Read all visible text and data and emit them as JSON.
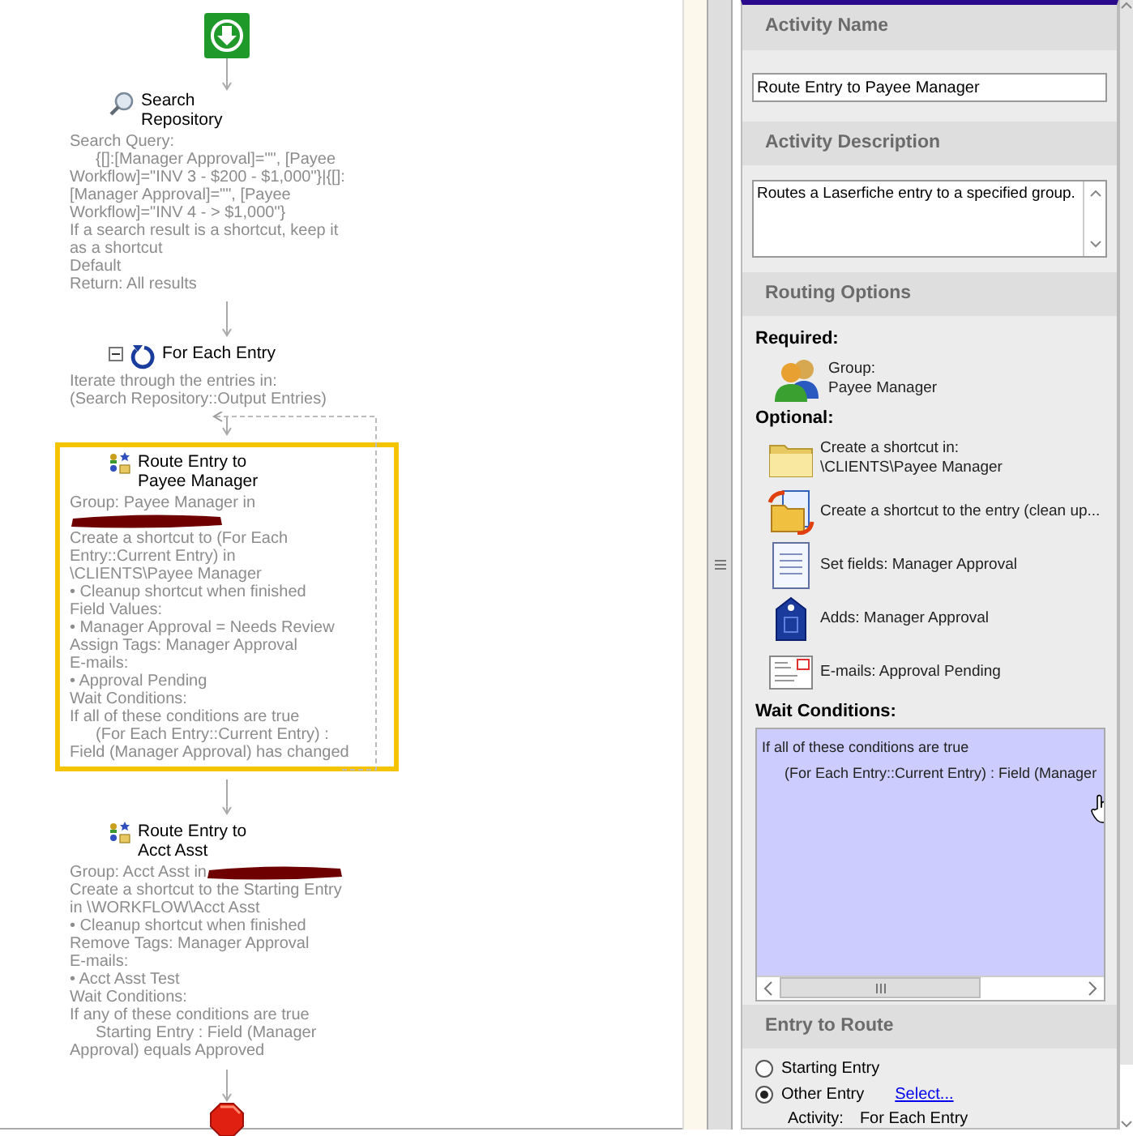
{
  "flow": [
    {
      "kind": "search",
      "title": "Search Repository",
      "selected": false,
      "lines": [
        {
          "text": "Search Query:",
          "indent": false,
          "redacted": false
        },
        {
          "text": "{[]:[Manager Approval]=\"\", [Payee Workflow]=\"INV 3 - $200 - $1,000\"}|{[]:[Manager Approval]=\"\", [Payee Workflow]=\"INV 4 - > $1,000\"}",
          "indent": true,
          "redacted": false
        },
        {
          "text": "If a search result is a shortcut, keep it as a shortcut",
          "indent": false,
          "redacted": false
        },
        {
          "text": "Default",
          "indent": false,
          "redacted": false
        },
        {
          "text": "Return: All results",
          "indent": false,
          "redacted": false
        }
      ]
    },
    {
      "kind": "loop",
      "title": "For Each Entry",
      "expanded": true,
      "selected": false,
      "lines": [
        {
          "text": "Iterate through the entries in:",
          "indent": false,
          "redacted": false
        },
        {
          "text": "(Search Repository::Output Entries)",
          "indent": false,
          "redacted": false
        }
      ]
    },
    {
      "kind": "route",
      "title": "Route Entry to Payee Manager",
      "selected": true,
      "lines": [
        {
          "text": "Group: Payee Manager in",
          "indent": false,
          "redacted": true
        },
        {
          "text": "Create a shortcut to (For Each Entry::Current Entry) in \\CLIENTS\\Payee Manager",
          "indent": false,
          "redacted": false
        },
        {
          "text": "• Cleanup shortcut when finished",
          "indent": false,
          "redacted": false
        },
        {
          "text": "Field Values:",
          "indent": false,
          "redacted": false
        },
        {
          "text": "• Manager Approval = Needs Review",
          "indent": false,
          "redacted": false
        },
        {
          "text": "Assign Tags: Manager Approval",
          "indent": false,
          "redacted": false
        },
        {
          "text": "E-mails:",
          "indent": false,
          "redacted": false
        },
        {
          "text": "• Approval Pending",
          "indent": false,
          "redacted": false
        },
        {
          "text": "Wait Conditions:",
          "indent": false,
          "redacted": false
        },
        {
          "text": "If all of these conditions are true",
          "indent": false,
          "redacted": false
        },
        {
          "text": "(For Each Entry::Current Entry) : Field (Manager Approval) has changed",
          "indent": true,
          "redacted": false
        }
      ]
    },
    {
      "kind": "route",
      "title": "Route Entry to Acct Asst",
      "selected": false,
      "lines": [
        {
          "text": "Group: Acct Asst in",
          "indent": false,
          "redacted": true
        },
        {
          "text": "Create a shortcut to the Starting Entry in \\WORKFLOW\\Acct Asst",
          "indent": false,
          "redacted": false
        },
        {
          "text": "• Cleanup shortcut when finished",
          "indent": false,
          "redacted": false
        },
        {
          "text": "Remove Tags: Manager Approval",
          "indent": false,
          "redacted": false
        },
        {
          "text": "E-mails:",
          "indent": false,
          "redacted": false
        },
        {
          "text": "• Acct Asst Test",
          "indent": false,
          "redacted": false
        },
        {
          "text": "Wait Conditions:",
          "indent": false,
          "redacted": false
        },
        {
          "text": "If any of these conditions are true",
          "indent": false,
          "redacted": false
        },
        {
          "text": "Starting Entry : Field (Manager Approval) equals Approved",
          "indent": true,
          "redacted": false
        }
      ]
    }
  ],
  "properties": {
    "activity_name": {
      "heading": "Activity Name",
      "value": "Route Entry to Payee Manager"
    },
    "activity_description": {
      "heading": "Activity Description",
      "value": "Routes a Laserfiche entry to a specified group."
    },
    "routing_options": {
      "heading": "Routing Options",
      "required_label": "Required:",
      "required": [
        {
          "kind": "group",
          "lines": [
            "Group:",
            "Payee Manager"
          ]
        }
      ],
      "optional_label": "Optional:",
      "optional": [
        {
          "kind": "folder",
          "lines": [
            "Create a shortcut in:",
            "\\CLIENTS\\Payee Manager"
          ]
        },
        {
          "kind": "shortcut",
          "lines": [
            "Create a shortcut to the entry (clean up..."
          ]
        },
        {
          "kind": "fields",
          "lines": [
            "Set fields: Manager Approval"
          ]
        },
        {
          "kind": "tag",
          "lines": [
            "Adds: Manager Approval"
          ]
        },
        {
          "kind": "email",
          "lines": [
            "E-mails: Approval Pending"
          ]
        }
      ],
      "wait_label": "Wait Conditions:",
      "wait_lines": [
        {
          "text": "If all of these conditions are true",
          "indent": false
        },
        {
          "text": "(For Each Entry::Current Entry) : Field (Manager",
          "indent": true
        }
      ]
    },
    "entry_to_route": {
      "heading": "Entry to Route",
      "options": [
        {
          "label": "Starting Entry",
          "selected": false
        },
        {
          "label": "Other Entry",
          "selected": true
        }
      ],
      "select_link": "Select...",
      "activity_label": "Activity:",
      "activity_value": "For Each Entry"
    }
  }
}
